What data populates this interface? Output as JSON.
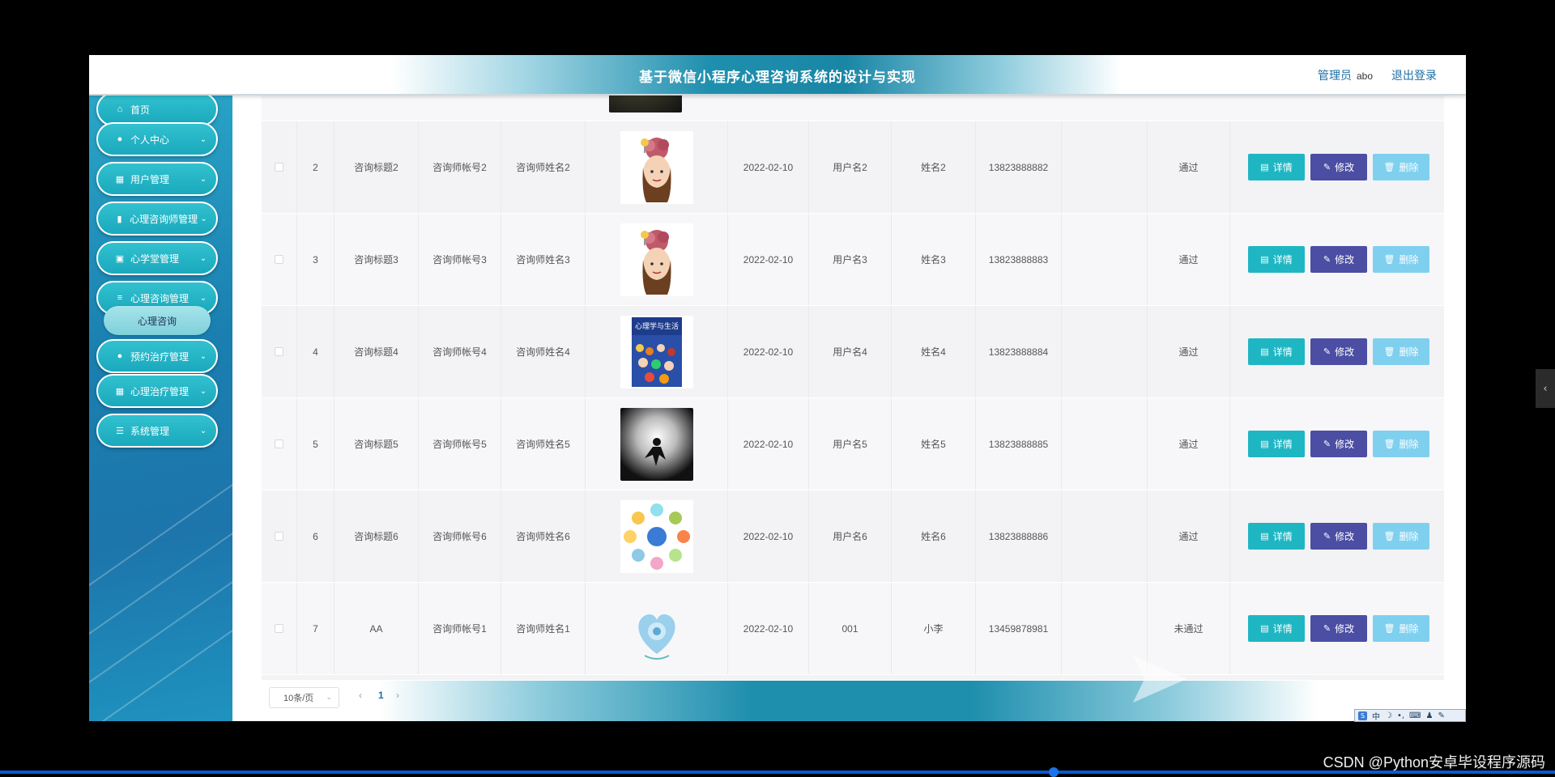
{
  "header": {
    "title": "基于微信小程序心理咨询系统的设计与实现",
    "user_role": "管理员",
    "username": "abo",
    "logout": "退出登录"
  },
  "sidebar": {
    "items": [
      {
        "label": "首页",
        "icon": "home-icon",
        "has_arrow": false
      },
      {
        "label": "个人中心",
        "icon": "user-icon",
        "has_arrow": true
      },
      {
        "label": "用户管理",
        "icon": "grid-icon",
        "has_arrow": true
      },
      {
        "label": "心理咨询师管理",
        "icon": "bar-chart-icon",
        "has_arrow": true
      },
      {
        "label": "心学堂管理",
        "icon": "clipboard-icon",
        "has_arrow": true
      },
      {
        "label": "心理咨询管理",
        "icon": "list-icon",
        "has_arrow": true
      },
      {
        "label": "预约治疗管理",
        "icon": "user-icon",
        "has_arrow": true
      },
      {
        "label": "心理治疗管理",
        "icon": "grid-icon",
        "has_arrow": true
      },
      {
        "label": "系统管理",
        "icon": "sliders-icon",
        "has_arrow": true
      }
    ],
    "submenu": {
      "label": "心理咨询"
    }
  },
  "table": {
    "buttons": {
      "detail": "详情",
      "edit": "修改",
      "delete": "删除"
    },
    "rows": [
      {
        "index": "2",
        "title": "咨询标题2",
        "account": "咨询师帐号2",
        "name": "咨询师姓名2",
        "image": "brain-girl",
        "date": "2022-02-10",
        "username": "用户名2",
        "realname": "姓名2",
        "phone": "13823888882",
        "status": "通过"
      },
      {
        "index": "3",
        "title": "咨询标题3",
        "account": "咨询师帐号3",
        "name": "咨询师姓名3",
        "image": "brain-girl",
        "date": "2022-02-10",
        "username": "用户名3",
        "realname": "姓名3",
        "phone": "13823888883",
        "status": "通过"
      },
      {
        "index": "4",
        "title": "咨询标题4",
        "account": "咨询师帐号4",
        "name": "咨询师姓名4",
        "image": "book-cover",
        "image_text": "心理学与生活",
        "date": "2022-02-10",
        "username": "用户名4",
        "realname": "姓名4",
        "phone": "13823888884",
        "status": "通过"
      },
      {
        "index": "5",
        "title": "咨询标题5",
        "account": "咨询师帐号5",
        "name": "咨询师姓名5",
        "image": "dark-figure",
        "date": "2022-02-10",
        "username": "用户名5",
        "realname": "姓名5",
        "phone": "13823888885",
        "status": "通过"
      },
      {
        "index": "6",
        "title": "咨询标题6",
        "account": "咨询师帐号6",
        "name": "咨询师姓名6",
        "image": "emoji-circle",
        "date": "2022-02-10",
        "username": "用户名6",
        "realname": "姓名6",
        "phone": "13823888886",
        "status": "通过"
      },
      {
        "index": "7",
        "title": "AA",
        "account": "咨询师帐号1",
        "name": "咨询师姓名1",
        "image": "heart-globe",
        "date": "2022-02-10",
        "username": "001",
        "realname": "小李",
        "phone": "13459878981",
        "status": "未通过"
      }
    ]
  },
  "pagination": {
    "page_size": "10条/页",
    "prev": "‹",
    "current_page": "1",
    "next": "›"
  },
  "overlay": {
    "credit": "CSDN @Python安卓毕设程序源码",
    "ime_label": "中"
  }
}
